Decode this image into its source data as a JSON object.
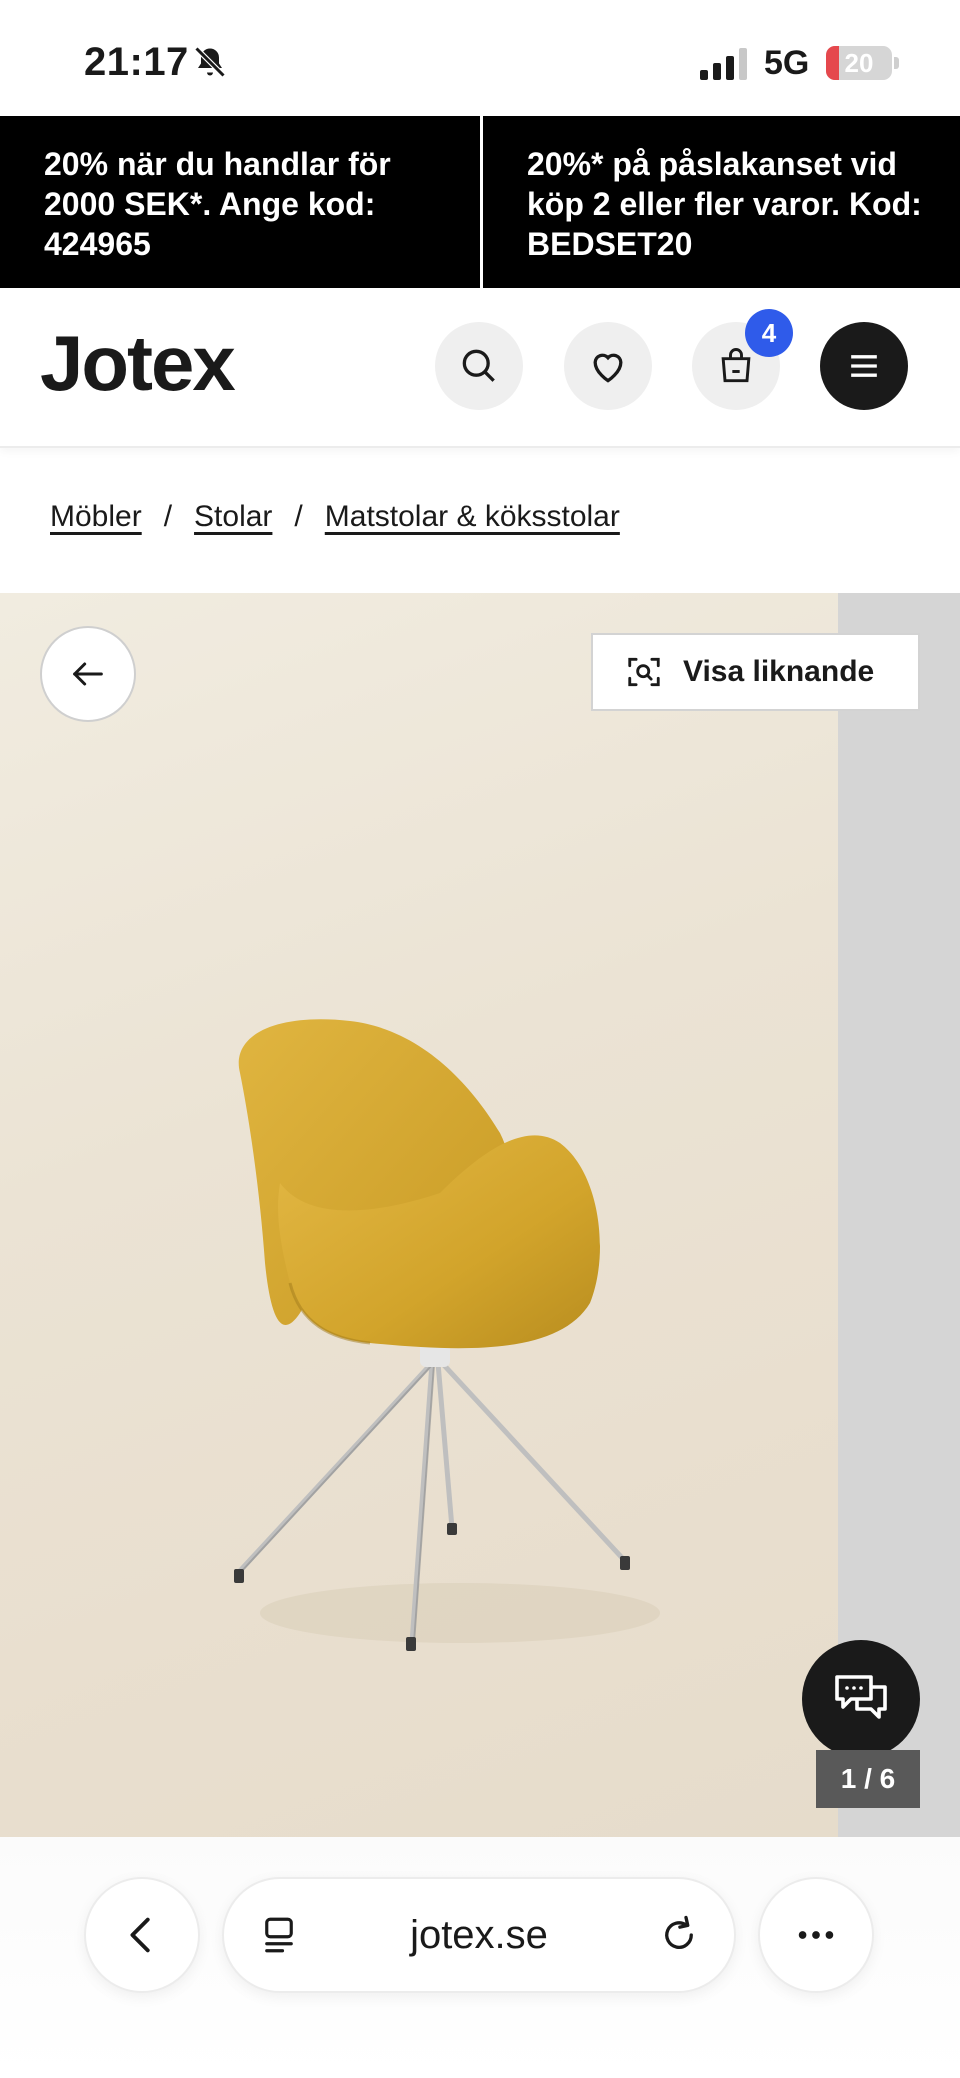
{
  "status_bar": {
    "time": "21:17",
    "network": "5G",
    "battery": "20",
    "battery_level": 0.2
  },
  "promo": {
    "left_text": "20% när du handlar för 2000 SEK*. Ange kod: 424965",
    "right_text": "20%* på påslakanset vid köp 2 eller fler varor. Kod: BEDSET20"
  },
  "header": {
    "logo": "Jotex",
    "cart_count": "4",
    "icons": [
      "search-icon",
      "heart-icon",
      "cart-icon",
      "menu-icon"
    ]
  },
  "breadcrumb": {
    "items": [
      "Möbler",
      "Stolar",
      "Matstolar & köksstolar"
    ],
    "separator": "/"
  },
  "gallery": {
    "similar_label": "Visa liknande",
    "counter": "1 / 6"
  },
  "browser": {
    "url": "jotex.se"
  },
  "colors": {
    "banner_bg": "#000000",
    "badge": "#2f5bea",
    "chair": "#d4a72c"
  }
}
